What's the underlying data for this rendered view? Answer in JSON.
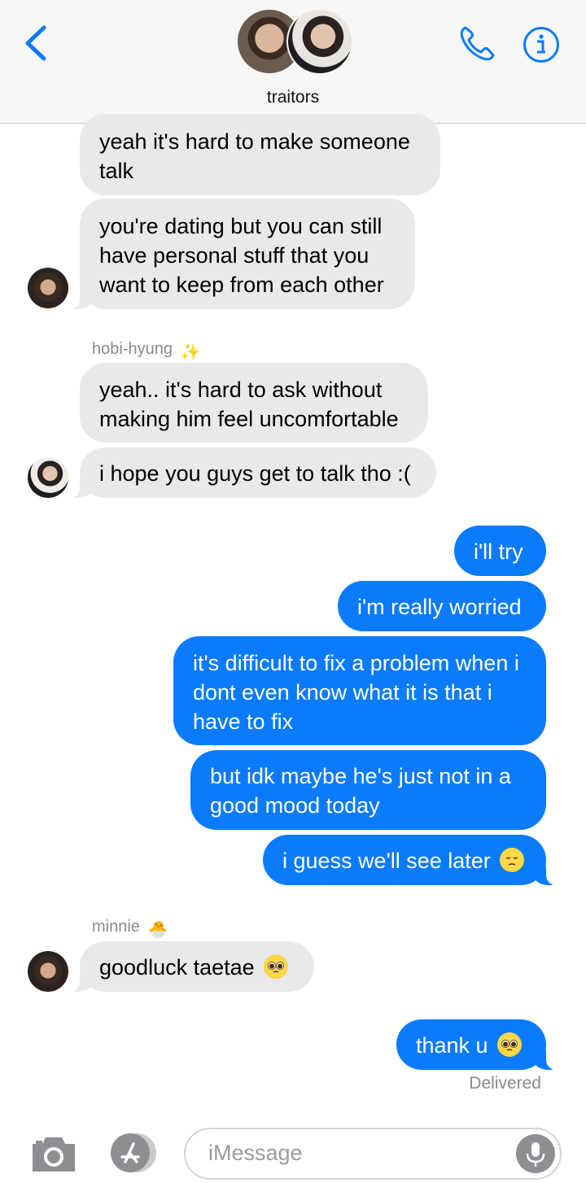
{
  "header": {
    "group_name": "traitors",
    "accent": "#0a7bfd"
  },
  "messages": [
    {
      "dir": "in",
      "text": "yeah it's hard to make someone talk"
    },
    {
      "dir": "in",
      "text": "you're dating but you can still have personal stuff that you want to keep from each other"
    },
    {
      "dir": "in",
      "sender": "hobi-hyung",
      "sender_emoji": "✨",
      "text": "yeah.. it's hard to ask without making him feel uncomfortable"
    },
    {
      "dir": "in",
      "text": "i hope you guys get to talk tho :("
    },
    {
      "dir": "out",
      "text": "i'll try"
    },
    {
      "dir": "out",
      "text": "i'm really worried"
    },
    {
      "dir": "out",
      "text": "it's difficult to fix a problem when i dont even know what it is that i have to fix"
    },
    {
      "dir": "out",
      "text": "but idk maybe he's just not in a good mood today"
    },
    {
      "dir": "out",
      "text": "i guess we'll see later",
      "emoji": "pensive-face"
    },
    {
      "dir": "in",
      "sender": "minnie",
      "sender_emoji": "🐣",
      "text": "goodluck taetae",
      "emoji": "pleading-face"
    },
    {
      "dir": "out",
      "text": "thank u",
      "emoji": "pleading-face"
    }
  ],
  "status": "Delivered",
  "composer": {
    "placeholder": "iMessage",
    "icons": [
      "camera-icon",
      "app-store-icon",
      "microphone-icon"
    ]
  },
  "colors": {
    "incoming_bubble": "#e9e9eb",
    "outgoing_bubble": "#0a7bfd",
    "meta_text": "#8a8a8e"
  }
}
